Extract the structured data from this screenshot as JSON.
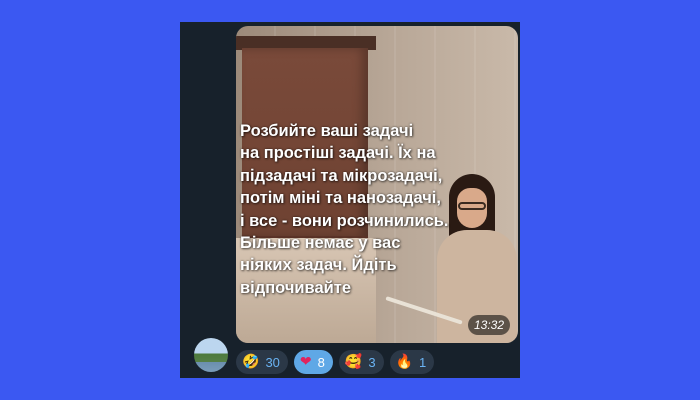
{
  "message": {
    "overlay_text": "Розбийте ваші задачі\nна простіші задачі. Їх на\nпідзадачі та мікрозадачі,\nпотім міні та нанозадачі,\nі все - вони розчинились.\nБільше немає у вас\nніяких задач. Йдіть\nвідпочивайте",
    "duration": "13:32"
  },
  "reactions": [
    {
      "emoji": "🤣",
      "count": "30",
      "active": false
    },
    {
      "emoji": "❤",
      "count": "8",
      "active": true
    },
    {
      "emoji": "🥰",
      "count": "3",
      "active": false
    },
    {
      "emoji": "🔥",
      "count": "1",
      "active": false
    }
  ],
  "colors": {
    "background": "#3b58f2",
    "panel": "#17212b",
    "reaction_active": "#5fa8e6",
    "reaction_idle": "#2b3847"
  }
}
